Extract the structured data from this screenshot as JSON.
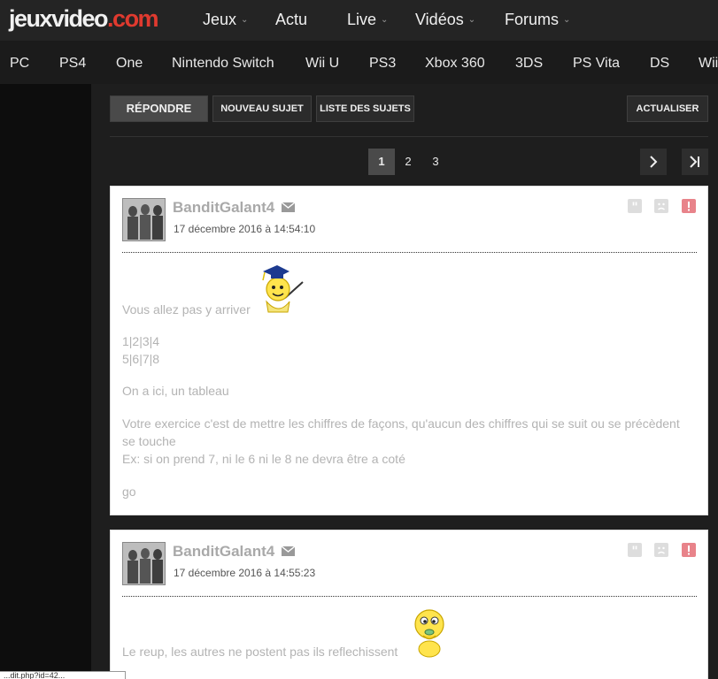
{
  "logo": {
    "part1": "jeuxvideo",
    "part2": ".com"
  },
  "nav": [
    {
      "label": "Jeux",
      "dropdown": true
    },
    {
      "label": "Actu",
      "dropdown": false
    },
    {
      "label": "Live",
      "dropdown": true
    },
    {
      "label": "Vidéos",
      "dropdown": true
    },
    {
      "label": "Forums",
      "dropdown": true
    }
  ],
  "platforms": [
    "PC",
    "PS4",
    "One",
    "Nintendo Switch",
    "Wii U",
    "PS3",
    "Xbox 360",
    "3DS",
    "PS Vita",
    "DS",
    "Wii"
  ],
  "actions": {
    "reply": "RÉPONDRE",
    "new_topic": "NOUVEAU SUJET",
    "topic_list": "LISTE DES SUJETS",
    "refresh": "ACTUALISER"
  },
  "pagination": {
    "pages": [
      "1",
      "2",
      "3"
    ],
    "current": "1"
  },
  "posts": [
    {
      "author": "BanditGalant4",
      "date": "17 décembre 2016 à 14:54:10",
      "lines": [
        "Vous allez pas y arriver",
        "1|2|3|4",
        "5|6|7|8",
        "On a ici, un tableau",
        "Votre exercice c'est de mettre les chiffres de façons, qu'aucun des chiffres qui se suit ou se précèdent",
        "se touche",
        "Ex: si on prend 7, ni le 6 ni le 8 ne devra être a coté",
        "go"
      ]
    },
    {
      "author": "BanditGalant4",
      "date": "17 décembre 2016 à 14:55:23",
      "lines": [
        "Le reup, les autres ne postent pas ils reflechissent"
      ]
    }
  ],
  "status_tip": "...dit.php?id=42...",
  "colors": {
    "accent": "#e03a2f",
    "alert": "#e8838a"
  }
}
